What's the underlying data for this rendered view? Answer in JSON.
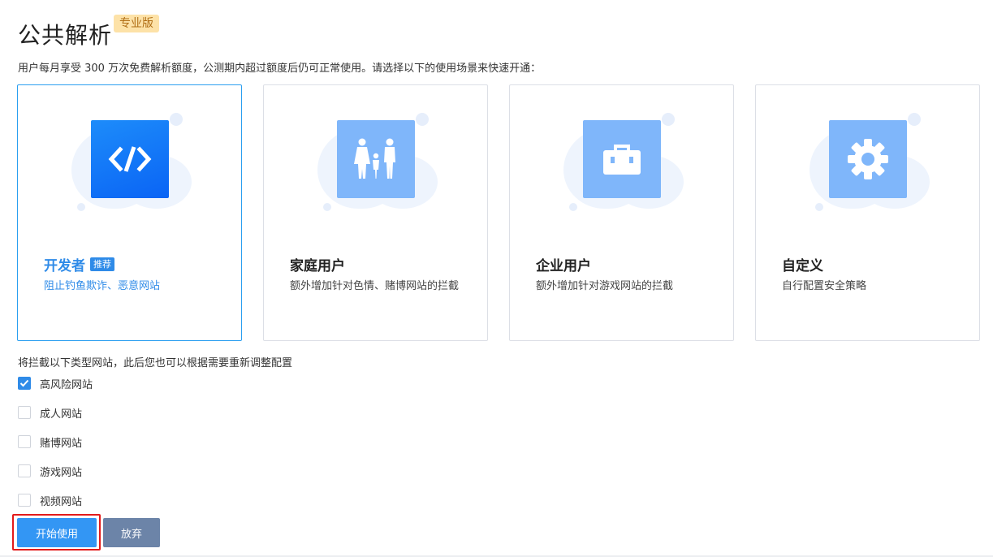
{
  "header": {
    "title": "公共解析",
    "edition_badge": "专业版",
    "description": "用户每月享受 300 万次免费解析额度，公测期内超过额度后仍可正常使用。请选择以下的使用场景来快速开通："
  },
  "scenarios": [
    {
      "title": "开发者",
      "badge": "推荐",
      "desc": "阻止钓鱼欺诈、恶意网站",
      "icon": "code-icon",
      "selected": true
    },
    {
      "title": "家庭用户",
      "desc": "额外增加针对色情、赌博网站的拦截",
      "icon": "family-icon",
      "selected": false
    },
    {
      "title": "企业用户",
      "desc": "额外增加针对游戏网站的拦截",
      "icon": "briefcase-icon",
      "selected": false
    },
    {
      "title": "自定义",
      "desc": "自行配置安全策略",
      "icon": "gear-icon",
      "selected": false
    }
  ],
  "filter": {
    "notice": "将拦截以下类型网站，此后您也可以根据需要重新调整配置",
    "options": [
      {
        "label": "高风险网站",
        "checked": true
      },
      {
        "label": "成人网站",
        "checked": false
      },
      {
        "label": "赌博网站",
        "checked": false
      },
      {
        "label": "游戏网站",
        "checked": false
      },
      {
        "label": "视频网站",
        "checked": false
      }
    ]
  },
  "actions": {
    "start_label": "开始使用",
    "abandon_label": "放弃"
  },
  "colors": {
    "accent": "#2f8be8",
    "highlight": "#e31b1b",
    "secondary_button": "#6c84a8"
  }
}
